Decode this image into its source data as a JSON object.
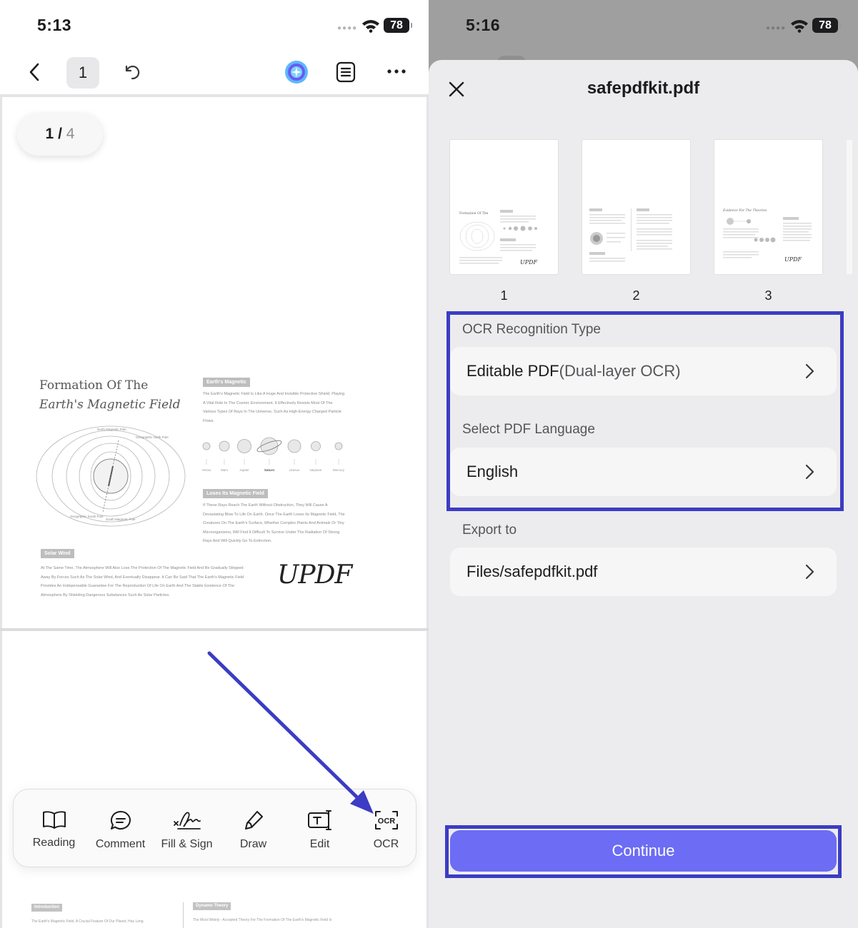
{
  "left": {
    "status": {
      "time": "5:13",
      "battery": "78"
    },
    "toolbar": {
      "page_number": "1"
    },
    "page_indicator": {
      "current": "1",
      "separator": " / ",
      "total": "4"
    },
    "document": {
      "title_line1": "Formation Of The",
      "title_line2": "Earth's Magnetic Field",
      "tag_earth": "Earth's Magnetic",
      "tag_loses": "Loses Its Magnetic Field",
      "tag_solar": "Solar Wind",
      "earth_text": "The Earth's Magnetic Field Is Like A Huge And Invisible Protective Shield, Playing A Vital Role In The Cosmic Environment. It Effectively Resists Most Of The Various Types Of Rays In The Universe, Such As High-Energy Charged Particle Flows.",
      "loses_text": "If These Rays Reach The Earth Without Obstruction, They Will Cause A Devastating Blow To Life On Earth. Once The Earth Loses Its Magnetic Field, The Creatures On The Earth's Surface, Whether Complex Plants And Animals Or Tiny Microorganisms, Will Find It Difficult To Survive Under The Radiation Of Strong Rays And Will Quickly Go To Extinction.",
      "solar_text": "At The Same Time, The Atmosphere Will Also Lose The Protection Of The Magnetic Field And Be Gradually Stripped Away By Forces Such As The Solar Wind, And Eventually Disappear. It Can Be Said That The Earth's Magnetic Field Provides An Indispensable Guarantee For The Reproduction Of Life On Earth And The Stable Existence Of The Atmosphere By Shielding Dangerous Substances Such As Solar Particles.",
      "planets": [
        "Venus",
        "Mars",
        "Jupiter",
        "Saturn",
        "Uranus",
        "Neptune",
        "Mercury"
      ],
      "north_label": "North Magnetic Pole",
      "geo_north_label": "Geographic North Pole",
      "geo_south_label": "Geographic South Pole",
      "south_label": "South Magnetic Pole",
      "signature": "UPDF",
      "tag_intro": "Introduction",
      "tag_dynamo": "Dynamo Theory",
      "intro_text": "The Earth's Magnetic Field, A Crucial Feature Of Our Planet, Has Long",
      "dynamo_text": "The Most Widely - Accepted Theory For The Formation Of The Earth's Magnetic Field Is"
    },
    "tools": [
      {
        "label": "Reading"
      },
      {
        "label": "Comment"
      },
      {
        "label": "Fill & Sign"
      },
      {
        "label": "Draw"
      },
      {
        "label": "Edit"
      },
      {
        "label": "OCR"
      }
    ]
  },
  "right": {
    "status": {
      "time": "5:16",
      "battery": "78"
    },
    "title": "safepdfkit.pdf",
    "thumbnails": [
      {
        "number": "1",
        "mini_title": "Formation Of The",
        "mini_sig": "UPDF"
      },
      {
        "number": "2"
      },
      {
        "number": "3",
        "mini_title": "Evidence For The Theories",
        "mini_sig": "UPDF"
      }
    ],
    "ocr_type": {
      "label": "OCR Recognition Type",
      "value": "Editable PDF",
      "value_sub": "(Dual-layer OCR)"
    },
    "language": {
      "label": "Select PDF Language",
      "value": "English"
    },
    "export": {
      "label": "Export to",
      "value": "Files/safepdfkit.pdf"
    },
    "continue_label": "Continue",
    "colors": {
      "accent": "#6c6cf5",
      "highlight": "#3c3cc4"
    }
  }
}
